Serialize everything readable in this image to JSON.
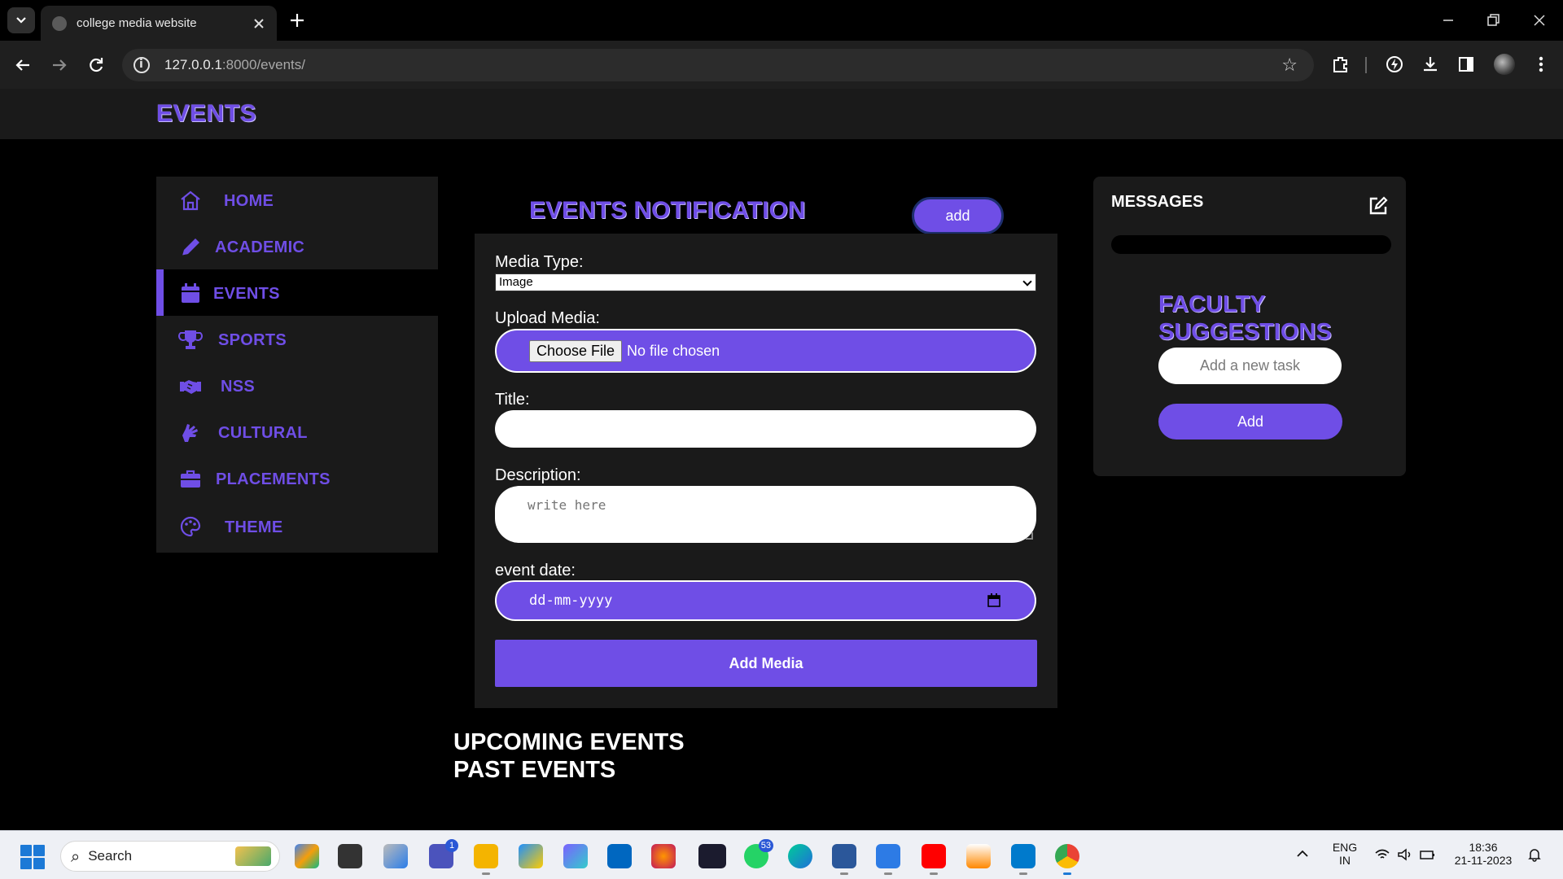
{
  "browser": {
    "tab_title": "college media website",
    "url_host": "127.0.0.1",
    "url_path": ":8000/events/"
  },
  "page": {
    "header_title": "EVENTS"
  },
  "sidebar": {
    "items": [
      {
        "label": "HOME",
        "icon": "home-icon"
      },
      {
        "label": "ACADEMIC",
        "icon": "pencil-icon"
      },
      {
        "label": "EVENTS",
        "icon": "calendar-icon",
        "active": true
      },
      {
        "label": "SPORTS",
        "icon": "trophy-icon"
      },
      {
        "label": "NSS",
        "icon": "handshake-icon"
      },
      {
        "label": "CULTURAL",
        "icon": "hands-icon"
      },
      {
        "label": "PLACEMENTS",
        "icon": "briefcase-icon"
      },
      {
        "label": "THEME",
        "icon": "palette-icon"
      }
    ]
  },
  "notification": {
    "title": "EVENTS NOTIFICATION",
    "add_label": "add"
  },
  "form": {
    "media_type_label": "Media Type:",
    "media_type_value": "Image",
    "upload_label": "Upload Media:",
    "choose_file_label": "Choose File",
    "no_file_text": "No file chosen",
    "title_label": "Title:",
    "title_value": "",
    "description_label": "Description:",
    "description_placeholder": "write here",
    "date_label": "event date:",
    "date_placeholder": "dd-mm-yyyy",
    "submit_label": "Add Media"
  },
  "sections": {
    "upcoming": "UPCOMING EVENTS",
    "past": "PAST EVENTS"
  },
  "messages": {
    "title": "MESSAGES",
    "faculty_title": "FACULTY SUGGESTIONS",
    "task_placeholder": "Add a new task",
    "task_add_label": "Add"
  },
  "taskbar": {
    "search_label": "Search",
    "teams_badge": "1",
    "whatsapp_badge": "53",
    "lang_line1": "ENG",
    "lang_line2": "IN",
    "time": "18:36",
    "date": "21-11-2023"
  },
  "colors": {
    "accent": "#6f4ee6",
    "card": "#1a1a1a",
    "background": "#000000"
  }
}
